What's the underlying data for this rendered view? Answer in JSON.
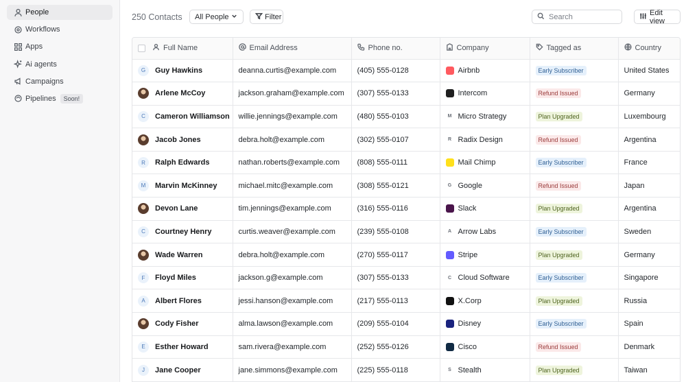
{
  "sidebar": {
    "items": [
      {
        "label": "People",
        "icon": "person-icon",
        "active": true
      },
      {
        "label": "Workflows",
        "icon": "workflow-icon"
      },
      {
        "label": "Apps",
        "icon": "apps-icon"
      },
      {
        "label": "Ai agents",
        "icon": "sparkle-icon"
      },
      {
        "label": "Campaigns",
        "icon": "megaphone-icon"
      },
      {
        "label": "Pipelines",
        "icon": "pipeline-icon",
        "badge": "Soon!"
      }
    ]
  },
  "toolbar": {
    "count": "250 Contacts",
    "view_select": "All People",
    "filter_label": "Filter",
    "search_placeholder": "Search",
    "edit_view_label": "Edit view"
  },
  "columns": [
    "Full Name",
    "Email Address",
    "Phone no.",
    "Company",
    "Tagged as",
    "Country"
  ],
  "rows": [
    {
      "name": "Guy Hawkins",
      "avatar": "G",
      "email": "deanna.curtis@example.com",
      "phone": "(405) 555-0128",
      "company": "Airbnb",
      "company_color": "#ff5a5f",
      "tag": "Early Subscriber",
      "tag_type": "blue",
      "country": "United States"
    },
    {
      "name": "Arlene McCoy",
      "avatar": "photo",
      "email": "jackson.graham@example.com",
      "phone": "(307) 555-0133",
      "company": "Intercom",
      "company_color": "#1f1f1f",
      "tag": "Refund Issued",
      "tag_type": "red",
      "country": "Germany"
    },
    {
      "name": "Cameron Williamson",
      "avatar": "C",
      "email": "willie.jennings@example.com",
      "phone": "(480) 555-0103",
      "company": "Micro Strategy",
      "company_color": "#e9e9ec",
      "company_glyph": "M",
      "tag": "Plan Upgraded",
      "tag_type": "green",
      "country": "Luxembourg"
    },
    {
      "name": "Jacob Jones",
      "avatar": "photo",
      "email": "debra.holt@example.com",
      "phone": "(302) 555-0107",
      "company": "Radix Design",
      "company_color": "#e9e9ec",
      "company_glyph": "R",
      "tag": "Refund Issued",
      "tag_type": "red",
      "country": "Argentina"
    },
    {
      "name": "Ralph Edwards",
      "avatar": "R",
      "email": "nathan.roberts@example.com",
      "phone": "(808) 555-0111",
      "company": "Mail Chimp",
      "company_color": "#ffe01b",
      "tag": "Early Subscriber",
      "tag_type": "blue",
      "country": "France"
    },
    {
      "name": "Marvin McKinney",
      "avatar": "M",
      "email": "michael.mitc@example.com",
      "phone": "(308) 555-0121",
      "company": "Google",
      "company_color": "#e9e9ec",
      "company_glyph": "G",
      "tag": "Refund Issued",
      "tag_type": "red",
      "country": "Japan"
    },
    {
      "name": "Devon Lane",
      "avatar": "photo",
      "email": "tim.jennings@example.com",
      "phone": "(316) 555-0116",
      "company": "Slack",
      "company_color": "#4a154b",
      "tag": "Plan Upgraded",
      "tag_type": "green",
      "country": "Argentina"
    },
    {
      "name": "Courtney Henry",
      "avatar": "C",
      "email": "curtis.weaver@example.com",
      "phone": "(239) 555-0108",
      "company": "Arrow Labs",
      "company_color": "#e9e9ec",
      "company_glyph": "A",
      "tag": "Early Subscriber",
      "tag_type": "blue",
      "country": "Sweden"
    },
    {
      "name": "Wade Warren",
      "avatar": "photo",
      "email": "debra.holt@example.com",
      "phone": "(270) 555-0117",
      "company": "Stripe",
      "company_color": "#635bff",
      "tag": "Plan Upgraded",
      "tag_type": "green",
      "country": "Germany"
    },
    {
      "name": "Floyd Miles",
      "avatar": "F",
      "email": "jackson.g@example.com",
      "phone": "(307) 555-0133",
      "company": "Cloud Software",
      "company_color": "#e9e9ec",
      "company_glyph": "C",
      "tag": "Early Subscriber",
      "tag_type": "blue",
      "country": "Singapore"
    },
    {
      "name": "Albert Flores",
      "avatar": "A",
      "email": "jessi.hanson@example.com",
      "phone": "(217) 555-0113",
      "company": "X.Corp",
      "company_color": "#111111",
      "tag": "Plan Upgraded",
      "tag_type": "green",
      "country": "Russia"
    },
    {
      "name": "Cody Fisher",
      "avatar": "photo",
      "email": "alma.lawson@example.com",
      "phone": "(209) 555-0104",
      "company": "Disney",
      "company_color": "#1a237e",
      "tag": "Early Subscriber",
      "tag_type": "blue",
      "country": "Spain"
    },
    {
      "name": "Esther Howard",
      "avatar": "E",
      "email": "sam.rivera@example.com",
      "phone": "(252) 555-0126",
      "company": "Cisco",
      "company_color": "#102a43",
      "tag": "Refund Issued",
      "tag_type": "red",
      "country": "Denmark"
    },
    {
      "name": "Jane Cooper",
      "avatar": "J",
      "email": "jane.simmons@example.com",
      "phone": "(225) 555-0118",
      "company": "Stealth",
      "company_color": "#e9e9ec",
      "company_glyph": "S",
      "tag": "Plan Upgraded",
      "tag_type": "green",
      "country": "Taiwan"
    }
  ]
}
